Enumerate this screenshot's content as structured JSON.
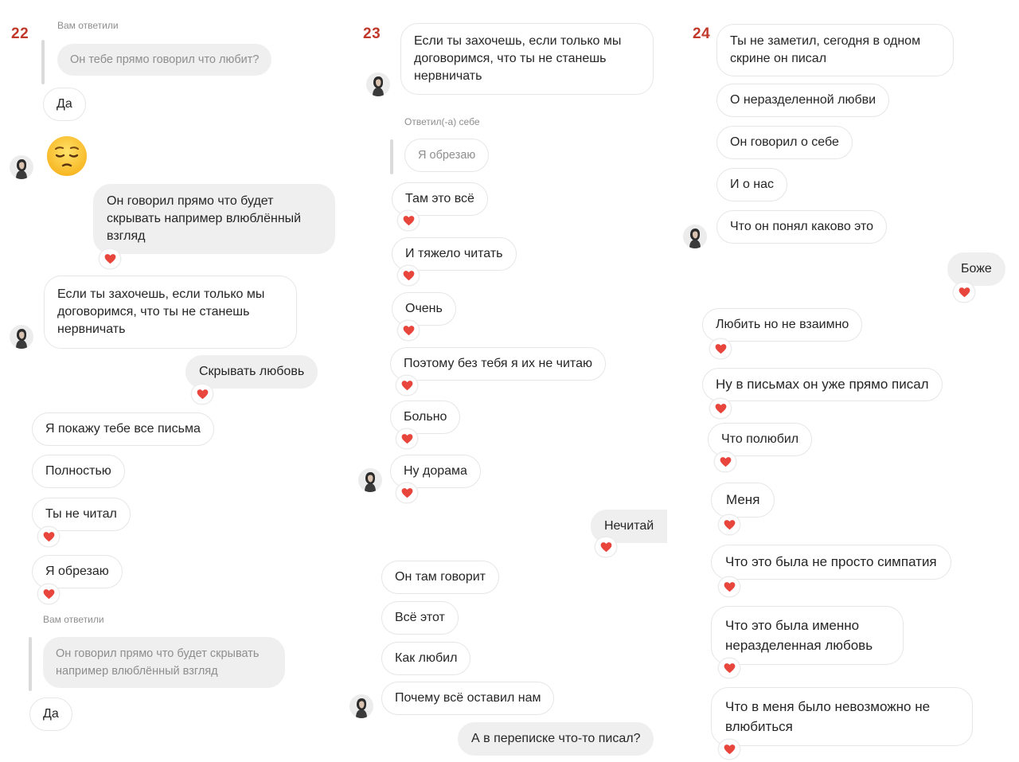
{
  "panels": [
    {
      "number": "22",
      "reply_label_1": "Вам ответили",
      "quote_1": "Он тебе прямо говорил что любит?",
      "msg_da_1": "Да",
      "emoji": "pensive-face",
      "out_1": "Он говорил прямо что будет скрывать например влюблённый взгляд",
      "in_1": "Если ты захочешь, если только мы договоримся, что ты не станешь нервничать",
      "out_2": "Скрывать любовь",
      "in_2": "Я покажу тебе все письма",
      "in_3": "Полностью",
      "in_4": "Ты не читал",
      "in_5": "Я обрезаю",
      "reply_label_2": "Вам ответили",
      "quote_2": "Он говорил прямо что будет скрывать например влюблённый взгляд",
      "msg_da_2": "Да"
    },
    {
      "number": "23",
      "in_1": "Если ты захочешь, если только мы договоримся, что ты не станешь нервничать",
      "reply_self_label": "Ответил(-а) себе",
      "quote_1": "Я обрезаю",
      "in_2": "Там это всё",
      "in_3": "И тяжело читать",
      "in_4": "Очень",
      "in_5": "Поэтому без тебя я их не читаю",
      "in_6": "Больно",
      "in_7": "Ну дорама",
      "out_1": "Нечитай",
      "in_8": "Он там говорит",
      "in_9": "Всё этот",
      "in_10": "Как любил",
      "in_11": "Почему всё оставил нам",
      "out_2": "А в переписке что-то писал?"
    },
    {
      "number": "24",
      "in_1": "Ты не заметил, сегодня в одном скрине он писал",
      "in_2": "О неразделенной любви",
      "in_3": "Он говорил о себе",
      "in_4": "И о нас",
      "in_5": "Что он понял каково это",
      "out_1": "Боже",
      "in_6": "Любить но не взаимно",
      "in_7": "Ну в письмах он уже прямо писал",
      "in_8": "Что полюбил",
      "in_9": "Меня",
      "in_10": "Что это была не просто симпатия",
      "in_11": "Что это была именно неразделенная любовь",
      "in_12": "Что в меня было невозможно не влюбиться"
    }
  ],
  "colors": {
    "panel_number": "#c0392b",
    "incoming_border": "#e6e6e6",
    "outgoing_bg": "#efefef",
    "heart": "#e8453c",
    "meta_text": "#8e8e8e"
  },
  "icons": {
    "reaction": "heart-icon",
    "avatar": "avatar-icon",
    "emoji": "pensive-face-emoji"
  }
}
